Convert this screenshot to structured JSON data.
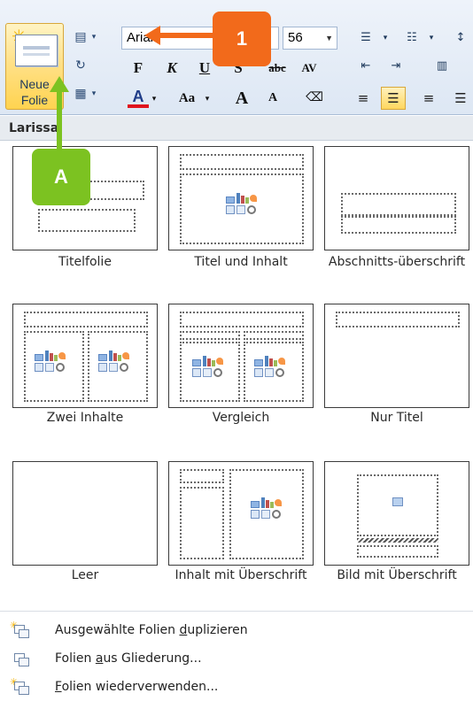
{
  "ribbon": {
    "new_slide_label_line1": "Neue",
    "new_slide_label_line2": "Folie",
    "font_name": "Arial",
    "font_size": "56",
    "bold": "F",
    "italic": "K",
    "underline": "U",
    "shadow": "S",
    "strikethrough": "abc",
    "char_spacing": "AV",
    "font_color": "A",
    "change_case": "Aa",
    "grow_font": "A",
    "shrink_font": "A"
  },
  "panel": {
    "title": "Larissa",
    "layouts": [
      {
        "label": "Titelfolie"
      },
      {
        "label": "Titel und Inhalt"
      },
      {
        "label": "Abschnitts-überschrift"
      },
      {
        "label": "Zwei Inhalte"
      },
      {
        "label": "Vergleich"
      },
      {
        "label": "Nur Titel"
      },
      {
        "label": "Leer"
      },
      {
        "label": "Inhalt mit Überschrift"
      },
      {
        "label": "Bild mit Überschrift"
      }
    ]
  },
  "menu": {
    "items": [
      {
        "pre": "Ausgewählte Folien ",
        "ul": "d",
        "post": "uplizieren"
      },
      {
        "pre": "Folien ",
        "ul": "a",
        "post": "us Gliederung..."
      },
      {
        "pre": "",
        "ul": "F",
        "post": "olien wiederverwenden..."
      }
    ]
  },
  "annotations": {
    "callout_1": "1",
    "callout_a": "A"
  },
  "colors": {
    "orange_callout": "#f26a1b",
    "green_callout": "#7cc221",
    "active_button": "#ffd350"
  }
}
